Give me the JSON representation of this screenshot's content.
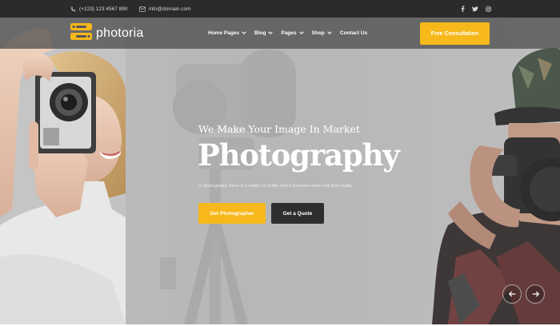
{
  "topbar": {
    "phone": "(+123) 123 4567 890",
    "email": "info@domain.com",
    "socials": [
      "facebook-icon",
      "twitter-icon",
      "instagram-icon"
    ]
  },
  "header": {
    "logo_text": "photoria",
    "nav": [
      {
        "label": "Home Pages",
        "has_dropdown": true
      },
      {
        "label": "Blog",
        "has_dropdown": true
      },
      {
        "label": "Pages",
        "has_dropdown": true
      },
      {
        "label": "Shop",
        "has_dropdown": true
      },
      {
        "label": "Contact Us",
        "has_dropdown": false
      }
    ],
    "cta_label": "Free Consultation"
  },
  "hero": {
    "subtitle": "We Make Your Image In Market",
    "title": "Photography",
    "tagline": "In photography there is a reality so subtle that it becomes more real than reality",
    "primary_button": "Get Photographer",
    "secondary_button": "Get a Quote"
  },
  "colors": {
    "accent": "#f7b81c",
    "topbar_bg": "#2b2b2b",
    "dark_button": "#2e2e2e"
  }
}
